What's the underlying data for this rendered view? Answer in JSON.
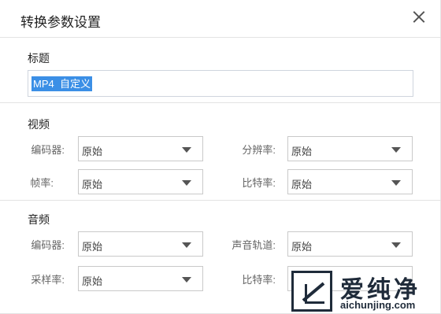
{
  "dialog": {
    "title": "转换参数设置",
    "close_icon": "close-icon"
  },
  "title_section": {
    "label": "标题",
    "value": "MP4  自定义"
  },
  "video": {
    "label": "视频",
    "encoder_label": "编码器:",
    "encoder_value": "原始",
    "resolution_label": "分辨率:",
    "resolution_value": "原始",
    "framerate_label": "帧率:",
    "framerate_value": "原始",
    "bitrate_label": "比特率:",
    "bitrate_value": "原始"
  },
  "audio": {
    "label": "音频",
    "encoder_label": "编码器:",
    "encoder_value": "原始",
    "channel_label": "声音轨道:",
    "channel_value": "原始",
    "samplerate_label": "采样率:",
    "samplerate_value": "原始",
    "bitrate_label": "比特率:",
    "bitrate_value": ""
  },
  "watermark": {
    "text": "爱纯净",
    "url": "aichunjing.com"
  }
}
